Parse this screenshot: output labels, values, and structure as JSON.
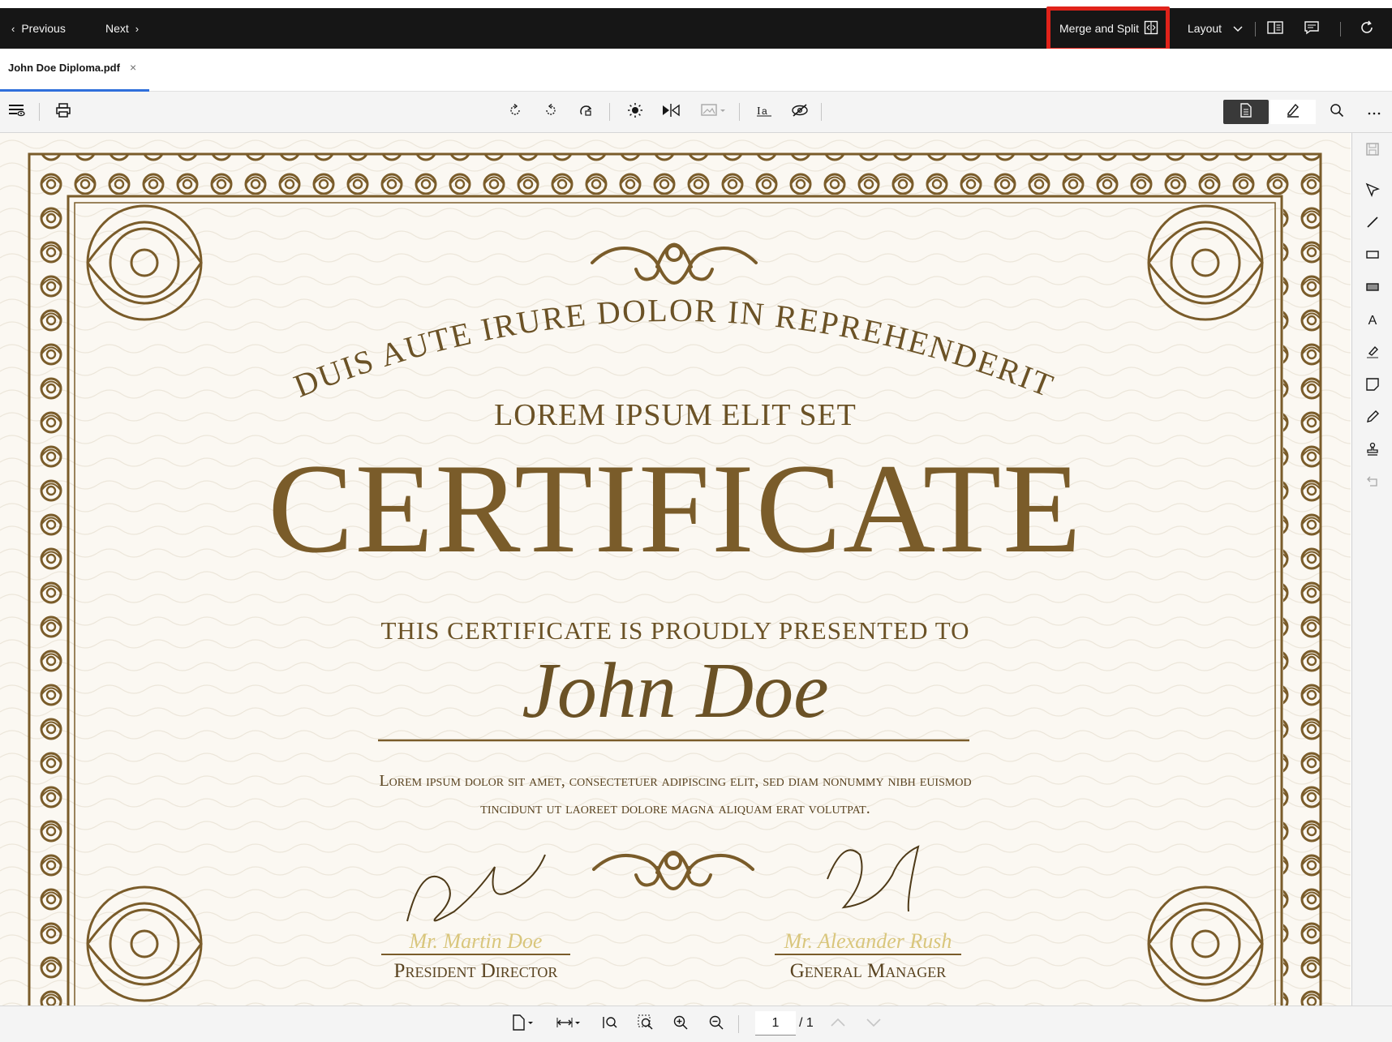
{
  "topbar": {
    "previous_label": "Previous",
    "next_label": "Next",
    "merge_split_label": "Merge and Split",
    "layout_label": "Layout"
  },
  "tab": {
    "filename": "John Doe Diploma.pdf",
    "close_glyph": "×"
  },
  "certificate": {
    "arc_text": "DUIS AUTE IRURE DOLOR IN REPREHENDERIT",
    "subtitle": "LOREM IPSUM ELIT SET",
    "title": "CERTIFICATE",
    "presented": "THIS CERTIFICATE IS PROUDLY PRESENTED TO",
    "recipient": "John Doe",
    "body_line1": "Lorem ipsum dolor sit amet, consectetuer adipiscing elit, sed diam nonummy nibh euismod",
    "body_line2": "tincidunt ut laoreet dolore magna aliquam erat volutpat.",
    "signer_left_name": "Mr. Martin Doe",
    "signer_left_role": "President Director",
    "signer_right_name": "Mr. Alexander Rush",
    "signer_right_role": "General Manager"
  },
  "pager": {
    "current_page": "1",
    "total_pages": "/ 1"
  },
  "colors": {
    "topbar_bg": "#161616",
    "highlight": "#e0221a",
    "tab_underline": "#2f6fdb",
    "certificate_gold": "#7a5c2a"
  }
}
